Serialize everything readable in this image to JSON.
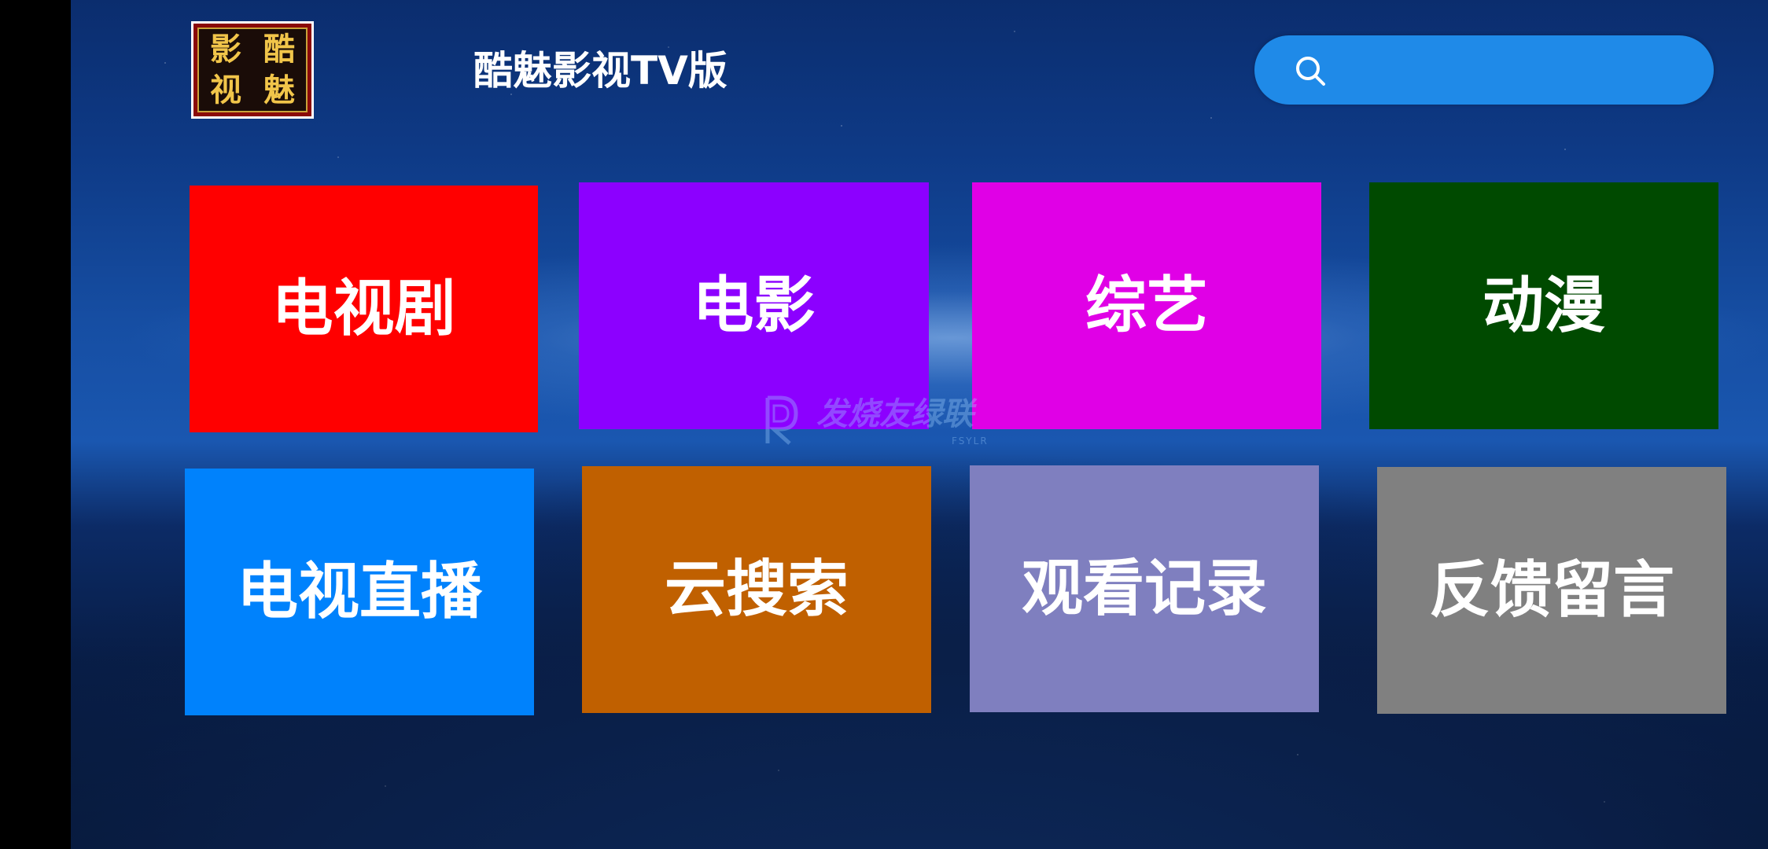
{
  "app": {
    "title": "酷魅影视TV版",
    "logo_chars": [
      "影",
      "酷",
      "视",
      "魅"
    ]
  },
  "search": {
    "icon": "search-icon",
    "bar_color": "#1f8ae8"
  },
  "tiles": [
    {
      "label": "电视剧",
      "color": "#ff0000"
    },
    {
      "label": "电影",
      "color": "#8c00ff"
    },
    {
      "label": "综艺",
      "color": "#e000e6"
    },
    {
      "label": "动漫",
      "color": "#004a00"
    },
    {
      "label": "电视直播",
      "color": "#0082fc"
    },
    {
      "label": "云搜索",
      "color": "#c06000"
    },
    {
      "label": "观看记录",
      "color": "#7f7fbf"
    },
    {
      "label": "反馈留言",
      "color": "#808080"
    }
  ],
  "watermark": {
    "text": "发烧友绿联",
    "sub": "FSYLR"
  }
}
